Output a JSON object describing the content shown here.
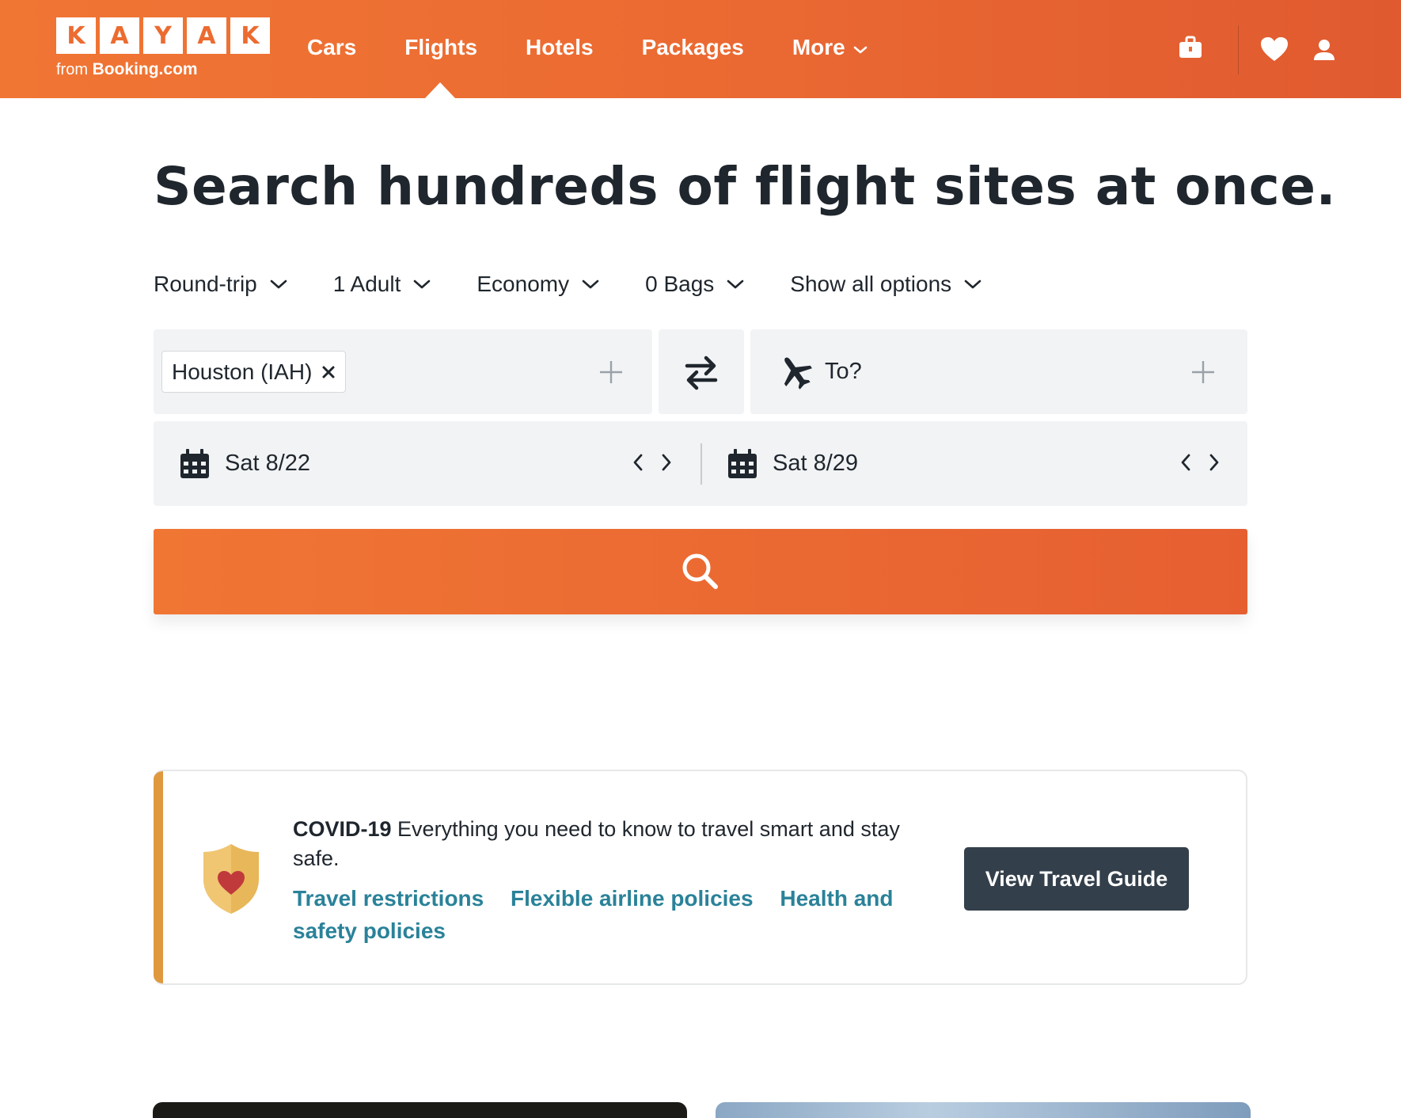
{
  "header": {
    "logo_letters": [
      "K",
      "A",
      "Y",
      "A",
      "K"
    ],
    "logo_from": "from",
    "logo_brand": "Booking.com",
    "nav": [
      {
        "label": "Cars"
      },
      {
        "label": "Flights"
      },
      {
        "label": "Hotels"
      },
      {
        "label": "Packages"
      },
      {
        "label": "More"
      }
    ],
    "active_nav": "Flights",
    "icons": [
      "trips-briefcase-icon",
      "heart-icon",
      "user-icon"
    ]
  },
  "main": {
    "title": "Search hundreds of flight sites at once.",
    "options": {
      "trip_type": "Round-trip",
      "travelers": "1 Adult",
      "cabin": "Economy",
      "bags": "0 Bags",
      "show_all": "Show all options"
    },
    "from": {
      "value": "Houston (IAH)"
    },
    "to": {
      "placeholder": "To?"
    },
    "depart_date": "Sat 8/22",
    "return_date": "Sat 8/29"
  },
  "covid": {
    "label": "COVID-19",
    "text": " Everything you need to know to travel smart and stay safe.",
    "links": [
      "Travel restrictions",
      "Flexible airline policies",
      "Health and safety policies"
    ],
    "button": "View Travel Guide"
  },
  "colors": {
    "brand_orange": "#ec6b30",
    "dark": "#1f262d",
    "link_teal": "#2a8299",
    "covid_accent": "#e0983f",
    "button_dark": "#333f4a"
  }
}
